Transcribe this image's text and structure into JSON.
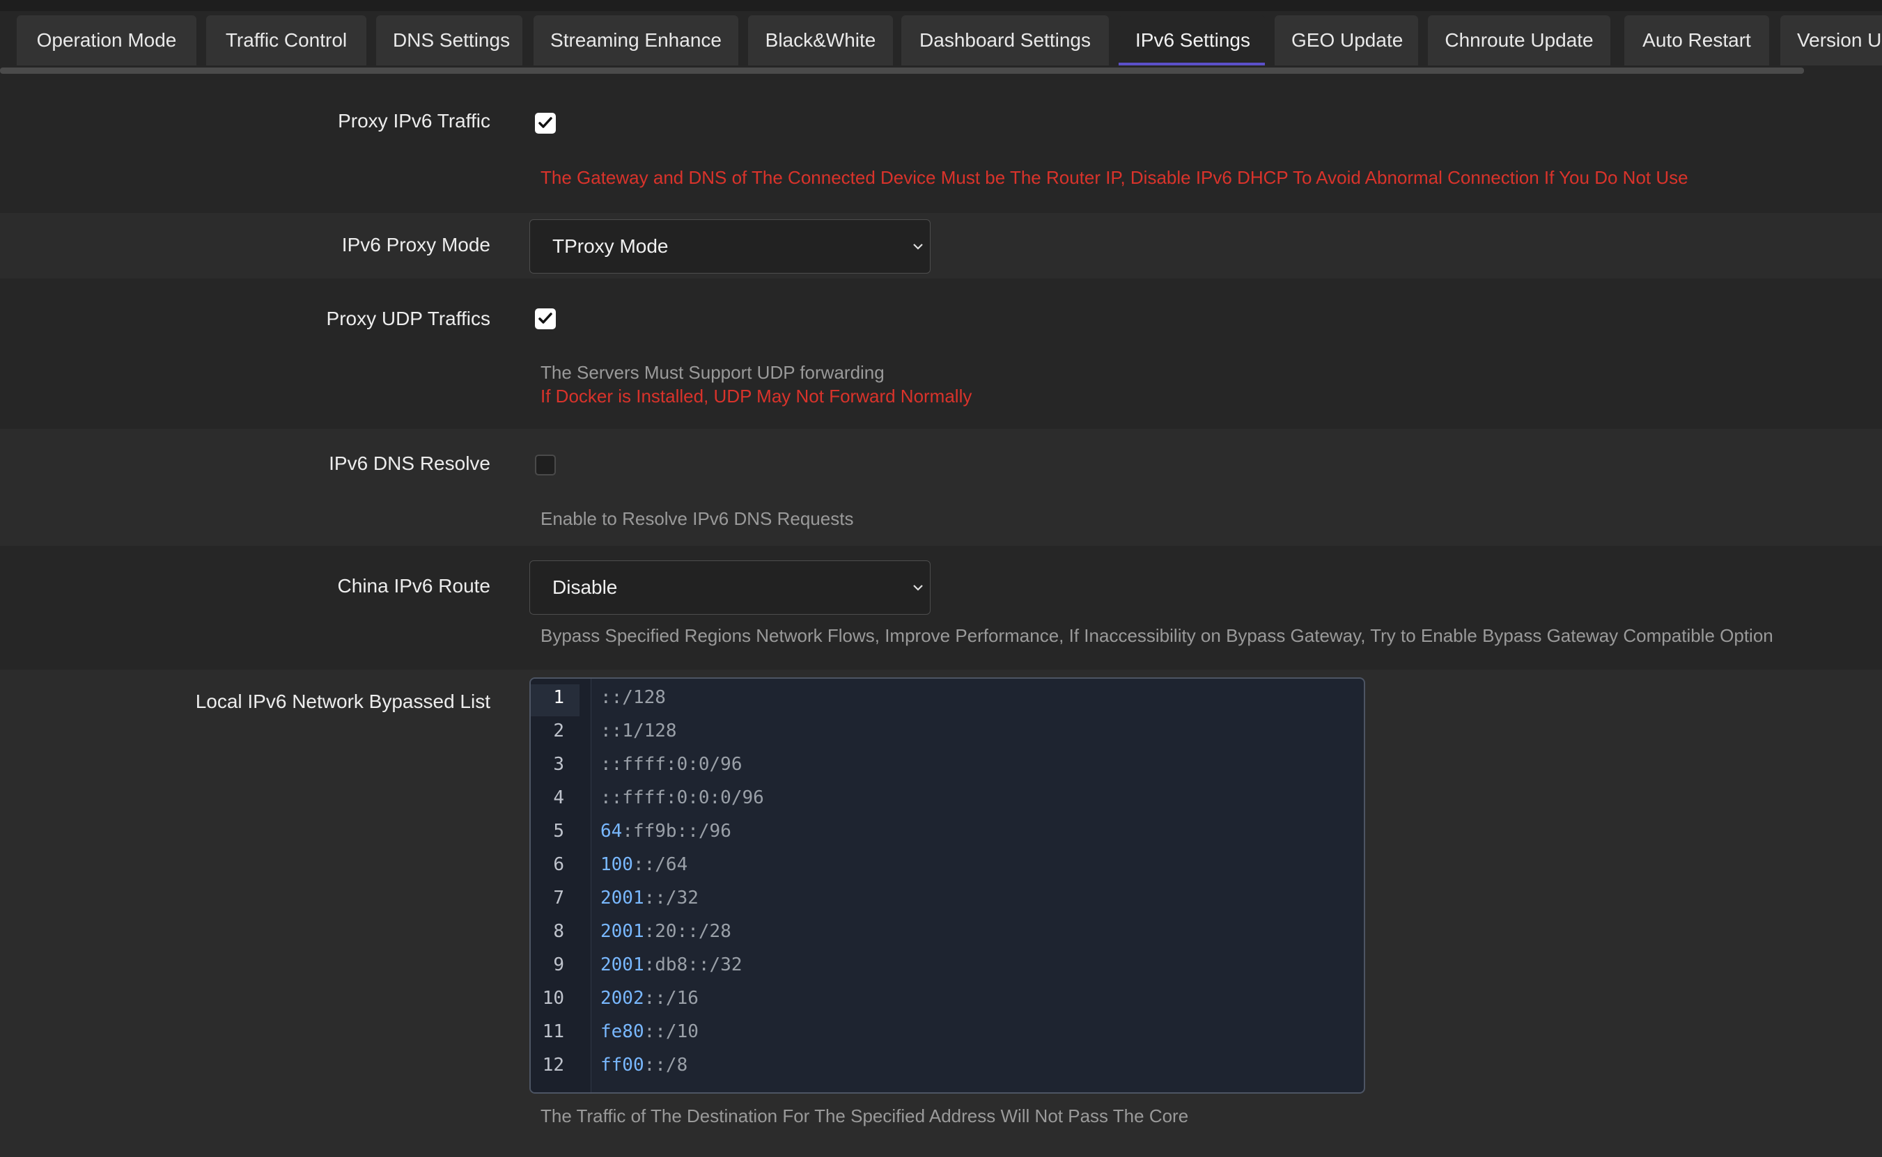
{
  "tabs": [
    {
      "label": "Operation Mode",
      "active": false
    },
    {
      "label": "Traffic Control",
      "active": false
    },
    {
      "label": "DNS Settings",
      "active": false
    },
    {
      "label": "Streaming Enhance",
      "active": false
    },
    {
      "label": "Black&White",
      "active": false
    },
    {
      "label": "Dashboard Settings",
      "active": false
    },
    {
      "label": "IPv6 Settings",
      "active": true
    },
    {
      "label": "GEO Update",
      "active": false
    },
    {
      "label": "Chnroute Update",
      "active": false
    },
    {
      "label": "Auto Restart",
      "active": false
    },
    {
      "label": "Version Up",
      "active": false
    }
  ],
  "proxy_ipv6_traffic": {
    "label": "Proxy IPv6 Traffic",
    "checked": true,
    "warning": "The Gateway and DNS of The Connected Device Must be The Router IP, Disable IPv6 DHCP To Avoid Abnormal Connection If You Do Not Use"
  },
  "ipv6_proxy_mode": {
    "label": "IPv6 Proxy Mode",
    "value": "TProxy Mode"
  },
  "proxy_udp_traffics": {
    "label": "Proxy UDP Traffics",
    "checked": true,
    "note": "The Servers Must Support UDP forwarding",
    "warning": "If Docker is Installed, UDP May Not Forward Normally"
  },
  "ipv6_dns_resolve": {
    "label": "IPv6 DNS Resolve",
    "checked": false,
    "note": "Enable to Resolve IPv6 DNS Requests"
  },
  "china_ipv6_route": {
    "label": "China IPv6 Route",
    "value": "Disable",
    "note": "Bypass Specified Regions Network Flows, Improve Performance, If Inaccessibility on Bypass Gateway, Try to Enable Bypass Gateway Compatible Option"
  },
  "bypass_list": {
    "label": "Local IPv6 Network Bypassed List",
    "note": "The Traffic of The Destination For The Specified Address Will Not Pass The Core",
    "lines": [
      {
        "n": "1",
        "num": "",
        "rest": "::/128"
      },
      {
        "n": "2",
        "num": "",
        "rest": "::1/128"
      },
      {
        "n": "3",
        "num": "",
        "rest": "::ffff:0:0/96"
      },
      {
        "n": "4",
        "num": "",
        "rest": "::ffff:0:0:0/96"
      },
      {
        "n": "5",
        "num": "64",
        "rest": ":ff9b::/96"
      },
      {
        "n": "6",
        "num": "100",
        "rest": "::/64"
      },
      {
        "n": "7",
        "num": "2001",
        "rest": "::/32"
      },
      {
        "n": "8",
        "num": "2001",
        "rest": ":20::/28"
      },
      {
        "n": "9",
        "num": "2001",
        "rest": ":db8::/32"
      },
      {
        "n": "10",
        "num": "2002",
        "rest": "::/16"
      },
      {
        "n": "11",
        "num": "fe80",
        "rest": "::/10"
      },
      {
        "n": "12",
        "num": "ff00",
        "rest": "::/8"
      }
    ]
  }
}
